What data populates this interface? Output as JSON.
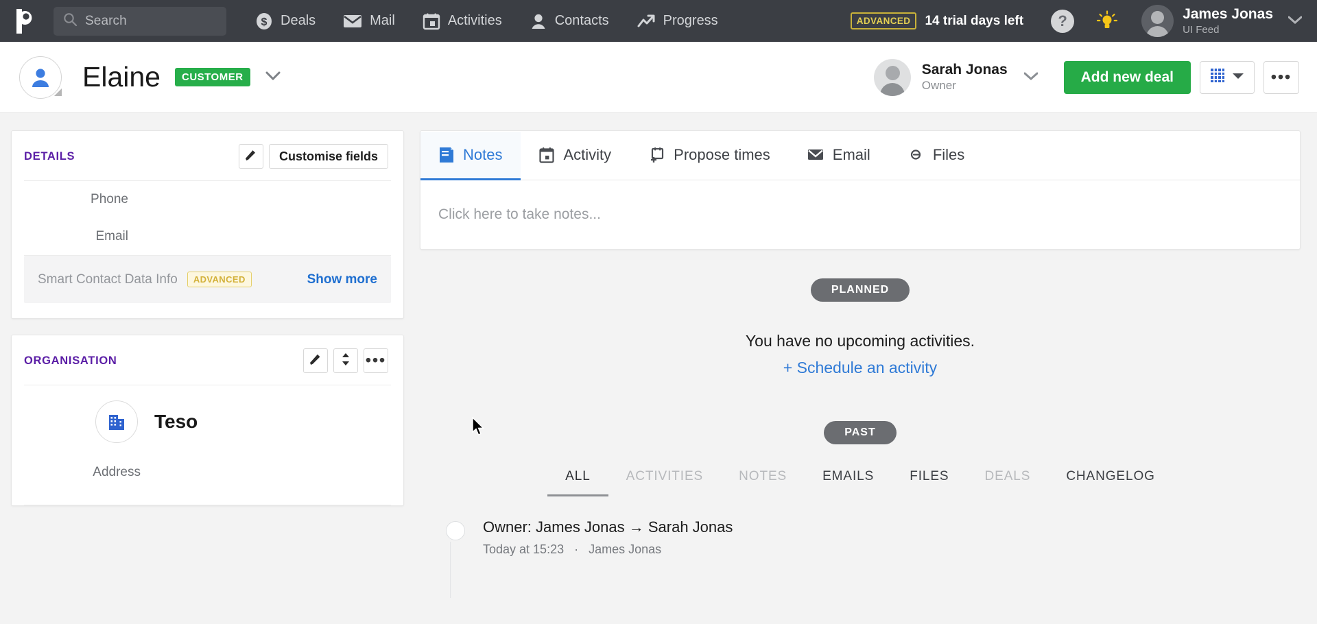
{
  "topnav": {
    "logo_icon": "pipedrive-logo-icon",
    "search": {
      "placeholder": "Search",
      "value": "",
      "icon": "search-icon"
    },
    "items": [
      {
        "label": "Deals",
        "icon": "dollar-circle-icon"
      },
      {
        "label": "Mail",
        "icon": "envelope-icon"
      },
      {
        "label": "Activities",
        "icon": "calendar-icon"
      },
      {
        "label": "Contacts",
        "icon": "person-icon"
      },
      {
        "label": "Progress",
        "icon": "trend-up-icon"
      }
    ],
    "plan_badge": "ADVANCED",
    "trial_text": "14 trial days left",
    "help_label": "?",
    "bulb_icon": "lightbulb-icon",
    "account": {
      "name": "James Jonas",
      "subtitle": "UI Feed",
      "avatar": "avatar-icon",
      "caret": "chevron-down-icon"
    }
  },
  "page_header": {
    "avatar_icon": "contact-person-icon",
    "title": "Elaine",
    "badge": "CUSTOMER",
    "title_caret": "chevron-down-icon",
    "owner": {
      "name": "Sarah Jonas",
      "role": "Owner",
      "caret": "chevron-down-icon"
    },
    "add_deal_label": "Add new deal",
    "grid_button_icon": "grid-view-icon",
    "grid_button_caret": "chevron-down-icon",
    "more_button_icon": "ellipsis-icon"
  },
  "sidebar": {
    "details": {
      "title": "DETAILS",
      "edit_icon": "pencil-icon",
      "customise_label": "Customise fields",
      "fields": [
        {
          "label": "Phone",
          "value": ""
        },
        {
          "label": "Email",
          "value": ""
        }
      ],
      "smart": {
        "label": "Smart Contact Data Info",
        "badge": "ADVANCED",
        "show_more": "Show more"
      }
    },
    "organisation": {
      "title": "ORGANISATION",
      "edit_icon": "pencil-icon",
      "sort_icon": "updown-arrows-icon",
      "more_icon": "ellipsis-icon",
      "org_logo_icon": "building-icon",
      "name": "Teso",
      "address_label": "Address",
      "address_value": ""
    }
  },
  "main": {
    "tabs": [
      {
        "label": "Notes",
        "icon": "note-icon",
        "active": true
      },
      {
        "label": "Activity",
        "icon": "calendar-icon",
        "active": false
      },
      {
        "label": "Propose times",
        "icon": "calendar-plus-icon",
        "active": false
      },
      {
        "label": "Email",
        "icon": "envelope-icon",
        "active": false
      },
      {
        "label": "Files",
        "icon": "paperclip-icon",
        "active": false
      }
    ],
    "note_placeholder": "Click here to take notes...",
    "planned": {
      "pill": "PLANNED",
      "empty_message": "You have no upcoming activities.",
      "schedule_link": "+ Schedule an activity"
    },
    "past": {
      "pill": "PAST",
      "filters": [
        {
          "label": "ALL",
          "state": "active"
        },
        {
          "label": "ACTIVITIES",
          "state": "muted"
        },
        {
          "label": "NOTES",
          "state": "muted"
        },
        {
          "label": "EMAILS",
          "state": "normal"
        },
        {
          "label": "FILES",
          "state": "normal"
        },
        {
          "label": "DEALS",
          "state": "muted"
        },
        {
          "label": "CHANGELOG",
          "state": "normal"
        }
      ],
      "feed": [
        {
          "title": "Owner: James Jonas → Sarah Jonas",
          "time": "Today at 15:23",
          "separator": "·",
          "author": "James Jonas"
        }
      ]
    }
  },
  "colors": {
    "topnav_bg": "#3b3e44",
    "accent_green": "#26ab47",
    "accent_blue": "#2f7ad6",
    "purple_heading": "#5b1ea6",
    "badge_gold": "#d3b13a"
  }
}
